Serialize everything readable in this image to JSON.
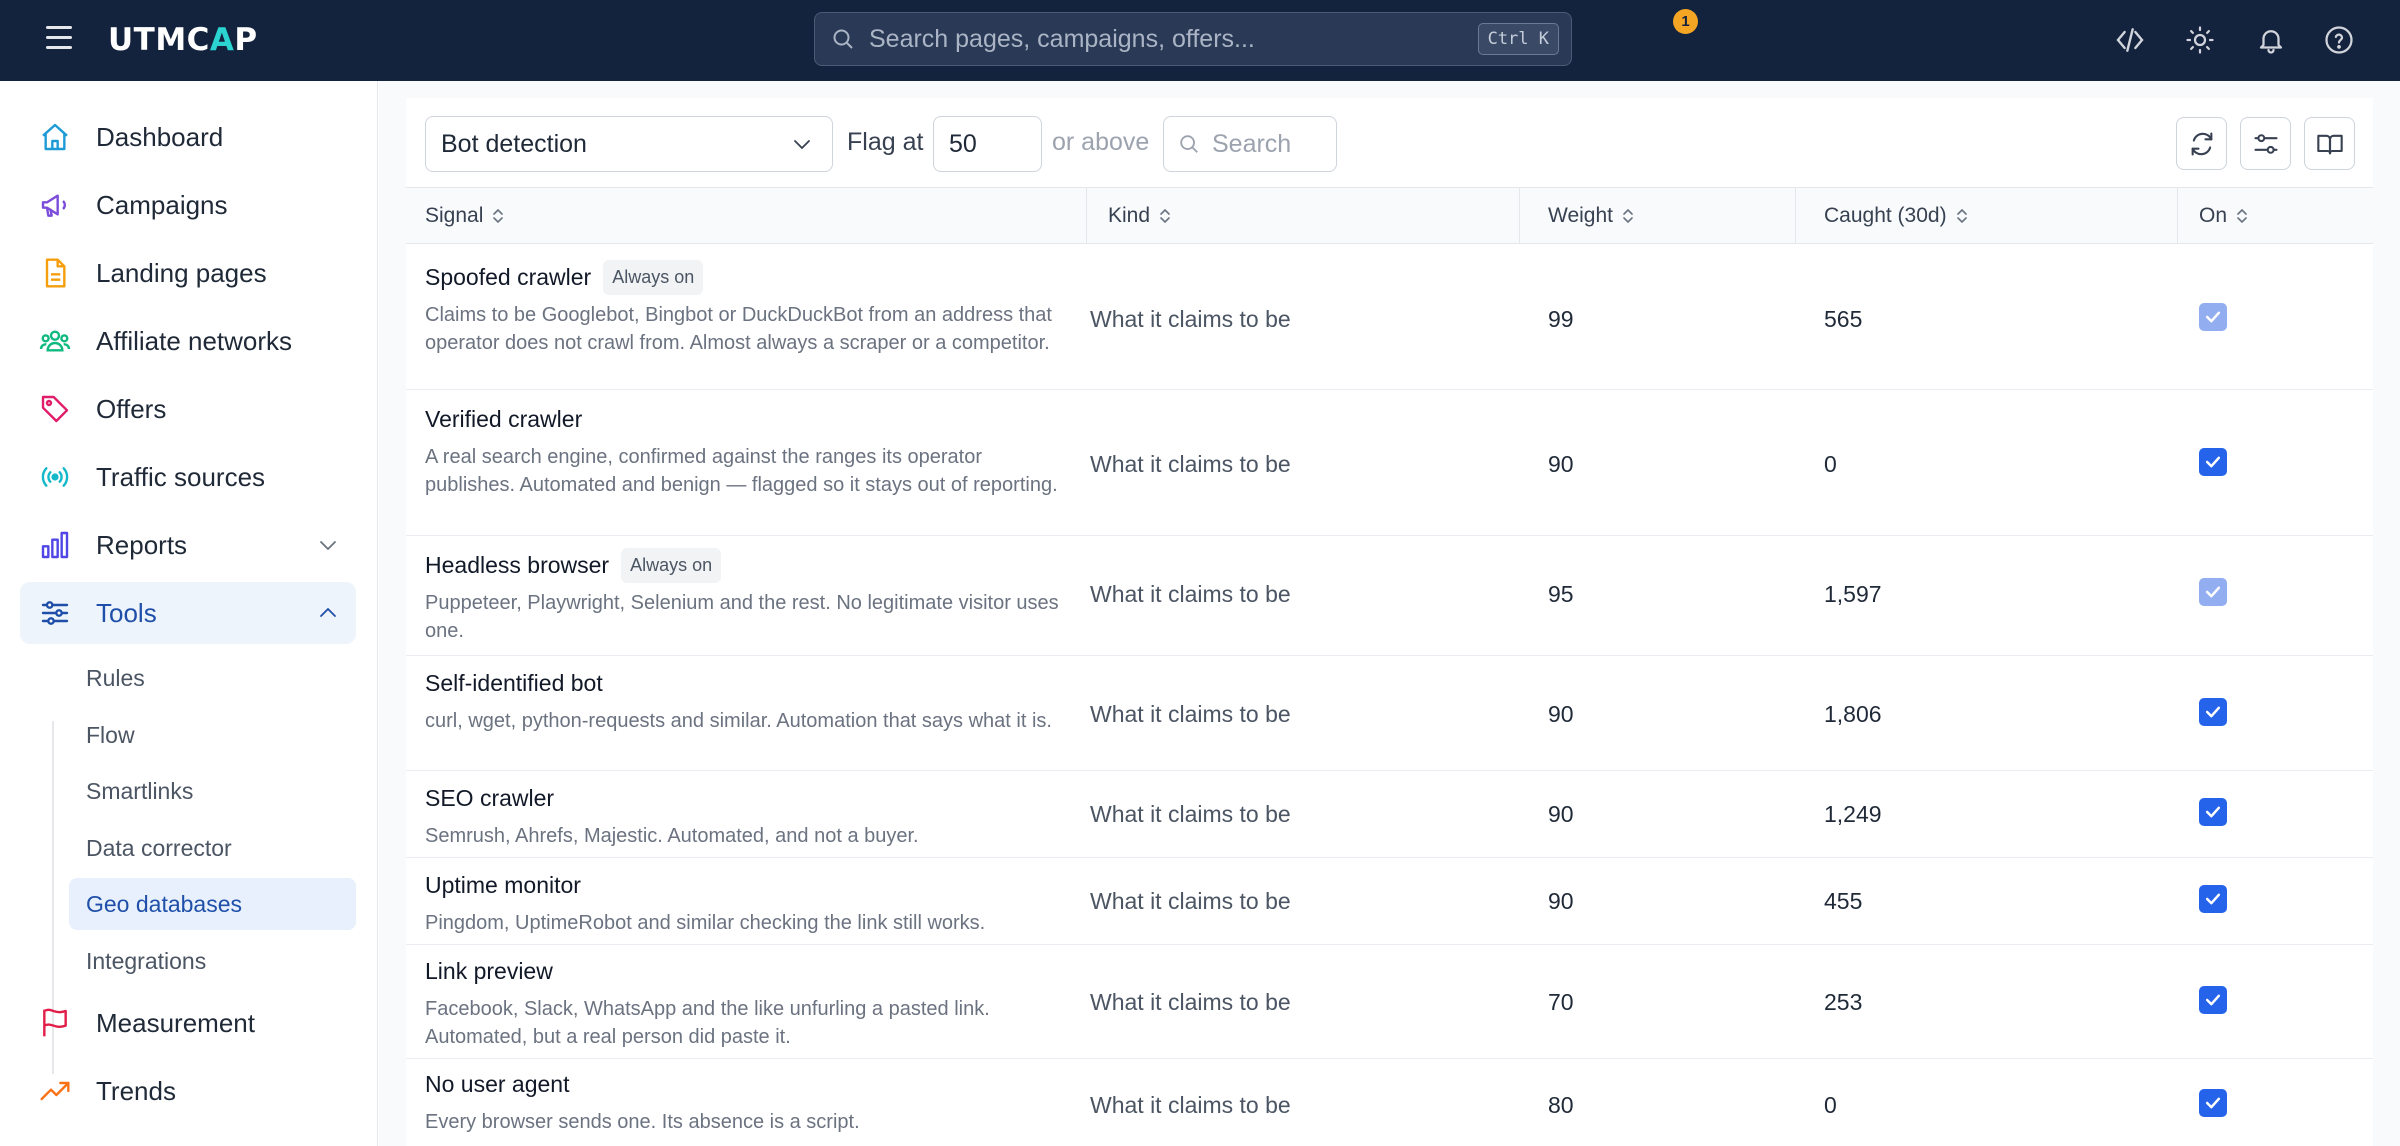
{
  "header": {
    "logo_left": "UTMC",
    "logo_accent": "A",
    "logo_right": "P",
    "search_placeholder": "Search pages, campaigns, offers...",
    "search_shortcut": "Ctrl K",
    "notification_count": "1"
  },
  "sidebar": {
    "items": [
      {
        "label": "Dashboard",
        "icon": "home-icon",
        "color": "#1e9bd7"
      },
      {
        "label": "Campaigns",
        "icon": "megaphone-icon",
        "color": "#7c4ddb"
      },
      {
        "label": "Landing pages",
        "icon": "document-icon",
        "color": "#f59e0b"
      },
      {
        "label": "Affiliate networks",
        "icon": "users-icon",
        "color": "#10b981"
      },
      {
        "label": "Offers",
        "icon": "tag-icon",
        "color": "#e11d6a"
      },
      {
        "label": "Traffic sources",
        "icon": "broadcast-icon",
        "color": "#14b8c8"
      },
      {
        "label": "Reports",
        "icon": "bar-chart-icon",
        "color": "#4f46e5"
      },
      {
        "label": "Tools",
        "icon": "sliders-icon",
        "color": "#1f4fa8"
      },
      {
        "label": "Measurement",
        "icon": "flag-icon",
        "color": "#e11d48"
      },
      {
        "label": "Trends",
        "icon": "trend-icon",
        "color": "#f97316"
      }
    ],
    "tools_sub": [
      "Rules",
      "Flow",
      "Smartlinks",
      "Data corrector",
      "Geo databases",
      "Integrations"
    ]
  },
  "toolbar": {
    "preset": "Bot detection",
    "flag_label": "Flag at",
    "flag_value": "50",
    "flag_suffix": "or above",
    "search_placeholder": "Search"
  },
  "table": {
    "columns": [
      "Signal",
      "Kind",
      "Weight",
      "Caught (30d)",
      "On"
    ],
    "rows": [
      {
        "name": "Spoofed crawler",
        "badge": "Always on",
        "desc": "Claims to be Googlebot, Bingbot or DuckDuckBot from an address that operator does not crawl from. Almost always a scraper or a competitor.",
        "kind": "What it claims to be",
        "weight": "99",
        "caught": "565",
        "on": true,
        "locked": true
      },
      {
        "name": "Verified crawler",
        "badge": "",
        "desc": "A real search engine, confirmed against the ranges its operator publishes. Automated and benign — flagged so it stays out of reporting.",
        "kind": "What it claims to be",
        "weight": "90",
        "caught": "0",
        "on": true,
        "locked": false
      },
      {
        "name": "Headless browser",
        "badge": "Always on",
        "desc": "Puppeteer, Playwright, Selenium and the rest. No legitimate visitor uses one.",
        "kind": "What it claims to be",
        "weight": "95",
        "caught": "1,597",
        "on": true,
        "locked": true
      },
      {
        "name": "Self-identified bot",
        "badge": "",
        "desc": "curl, wget, python-requests and similar. Automation that says what it is.",
        "kind": "What it claims to be",
        "weight": "90",
        "caught": "1,806",
        "on": true,
        "locked": false
      },
      {
        "name": "SEO crawler",
        "badge": "",
        "desc": "Semrush, Ahrefs, Majestic. Automated, and not a buyer.",
        "kind": "What it claims to be",
        "weight": "90",
        "caught": "1,249",
        "on": true,
        "locked": false
      },
      {
        "name": "Uptime monitor",
        "badge": "",
        "desc": "Pingdom, UptimeRobot and similar checking the link still works.",
        "kind": "What it claims to be",
        "weight": "90",
        "caught": "455",
        "on": true,
        "locked": false
      },
      {
        "name": "Link preview",
        "badge": "",
        "desc": "Facebook, Slack, WhatsApp and the like unfurling a pasted link. Automated, but a real person did paste it.",
        "kind": "What it claims to be",
        "weight": "70",
        "caught": "253",
        "on": true,
        "locked": false
      },
      {
        "name": "No user agent",
        "badge": "",
        "desc": "Every browser sends one. Its absence is a script.",
        "kind": "What it claims to be",
        "weight": "80",
        "caught": "0",
        "on": true,
        "locked": false
      }
    ]
  }
}
